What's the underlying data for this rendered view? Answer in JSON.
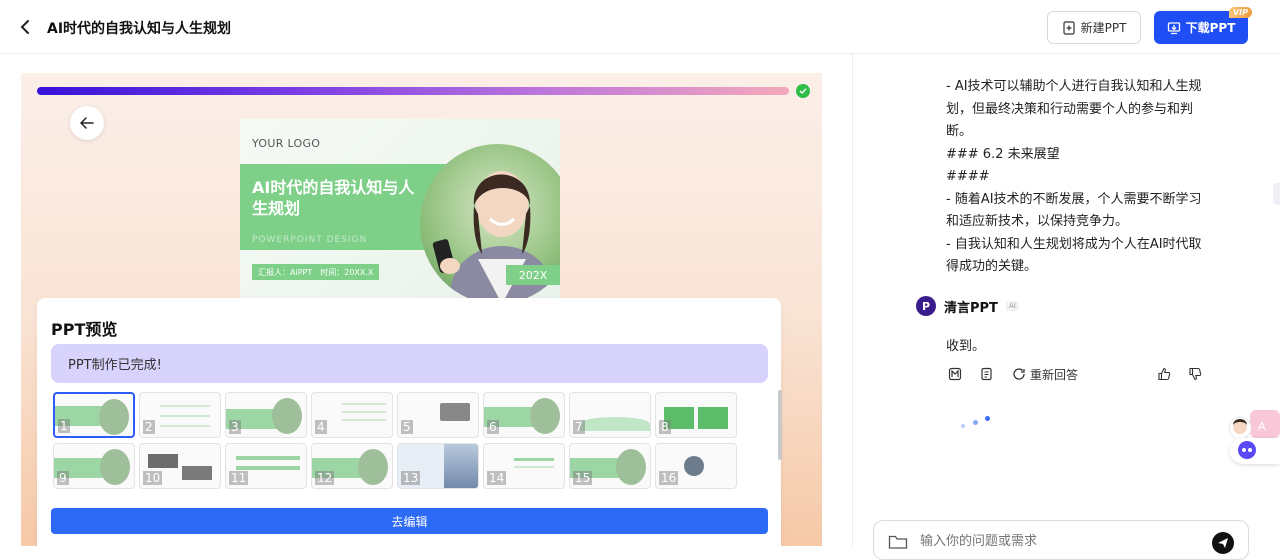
{
  "header": {
    "title": "AI时代的自我认知与人生规划",
    "new_ppt_label": "新建PPT",
    "download_label": "下载PPT",
    "vip_badge": "VIP"
  },
  "cover_slide": {
    "logo": "YOUR LOGO",
    "title": "AI时代的自我认知与人生规划",
    "subtitle": "POWERPOINT DESIGN",
    "reporter": "汇报人：AiPPT",
    "time": "时间：20XX.X",
    "year": "202X"
  },
  "preview": {
    "title": "PPT预览",
    "status": "PPT制作已完成!",
    "edit_label": "去编辑",
    "thumbnails": [
      "1",
      "2",
      "3",
      "4",
      "5",
      "6",
      "7",
      "8",
      "9",
      "10",
      "11",
      "12",
      "13",
      "14",
      "15",
      "16"
    ]
  },
  "chat": {
    "lines": [
      "- AI技术可以辅助个人进行自我认知和人生规划，但最终决策和行动需要个人的参与和判断。",
      "### 6.2 未来展望",
      "####",
      "- 随着AI技术的不断发展，个人需要不断学习和适应新技术，以保持竞争力。",
      "- 自我认知和人生规划将成为个人在AI时代取得成功的关键。"
    ],
    "bot_name": "清言PPT",
    "bot_avatar_letter": "P",
    "ai_tag": "AI",
    "reply": "收到。",
    "regenerate_label": "重新回答",
    "input_placeholder": "输入你的问题或需求"
  },
  "colors": {
    "primary": "#1f4ef5",
    "edit_button": "#2d6bf6",
    "status_bg": "#d7d3fd",
    "slide_green": "#7ecf88",
    "check_green": "#2fbd4a"
  }
}
